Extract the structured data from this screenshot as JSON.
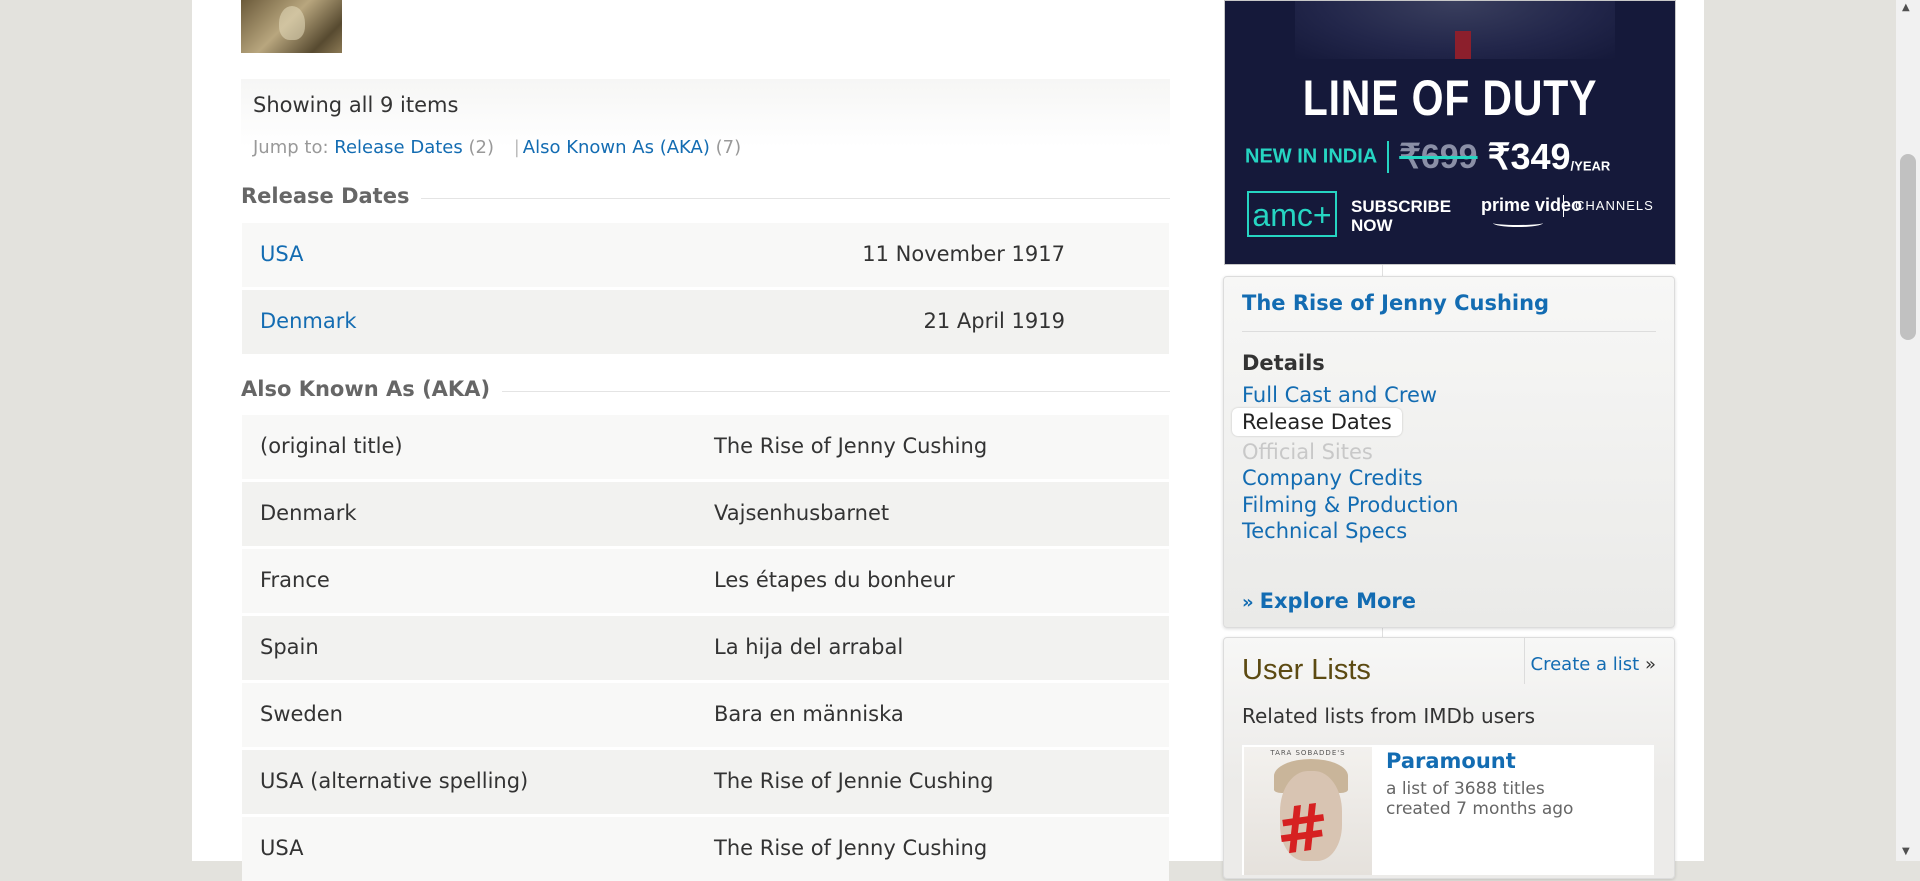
{
  "summary": {
    "showing": "Showing all 9 items",
    "jump_label": "Jump to:",
    "jump_links": [
      {
        "label": "Release Dates",
        "count": "(2)"
      },
      {
        "label": "Also Known As (AKA)",
        "count": "(7)"
      }
    ]
  },
  "release_dates": {
    "heading": "Release Dates",
    "rows": [
      {
        "country": "USA",
        "date": "11 November 1917"
      },
      {
        "country": "Denmark",
        "date": "21 April 1919"
      }
    ]
  },
  "aka": {
    "heading": "Also Known As (AKA)",
    "rows": [
      {
        "region": "(original title)",
        "title": "The Rise of Jenny Cushing"
      },
      {
        "region": "Denmark",
        "title": "Vajsenhusbarnet"
      },
      {
        "region": "France",
        "title": "Les étapes du bonheur"
      },
      {
        "region": "Spain",
        "title": "La hija del arrabal"
      },
      {
        "region": "Sweden",
        "title": "Bara en människa"
      },
      {
        "region": "USA (alternative spelling)",
        "title": "The Rise of Jennie Cushing"
      },
      {
        "region": "USA",
        "title": "The Rise of Jenny Cushing"
      }
    ]
  },
  "ad": {
    "title": "LINE OF DUTY",
    "new_in": "NEW IN INDIA",
    "old_price": "₹699",
    "new_price": "₹349",
    "per": "/YEAR",
    "amc": "amc+",
    "subscribe_1": "SUBSCRIBE",
    "subscribe_2": "NOW",
    "prime": "prime video",
    "channels": "CHANNELS"
  },
  "sidebar": {
    "title": "The Rise of Jenny Cushing",
    "details_heading": "Details",
    "links": [
      {
        "label": "Full Cast and Crew",
        "state": "link"
      },
      {
        "label": "Release Dates",
        "state": "current"
      },
      {
        "label": "Official Sites",
        "state": "disabled"
      },
      {
        "label": "Company Credits",
        "state": "link"
      },
      {
        "label": "Filming & Production",
        "state": "link"
      },
      {
        "label": "Technical Specs",
        "state": "link"
      }
    ],
    "explore_more": "Explore More"
  },
  "user_lists": {
    "heading": "User Lists",
    "create": "Create a list",
    "create_arrow": "»",
    "related": "Related lists from IMDb users",
    "list": {
      "name": "Paramount",
      "count_text": "a list of 3688 titles",
      "created_text": "created 7 months ago",
      "poster_tag": "TARA SOBADDE'S",
      "poster_mark": "#"
    }
  },
  "colors": {
    "link": "#136cb2",
    "heading": "#666666",
    "user_lists_heading": "#5c4a12"
  }
}
